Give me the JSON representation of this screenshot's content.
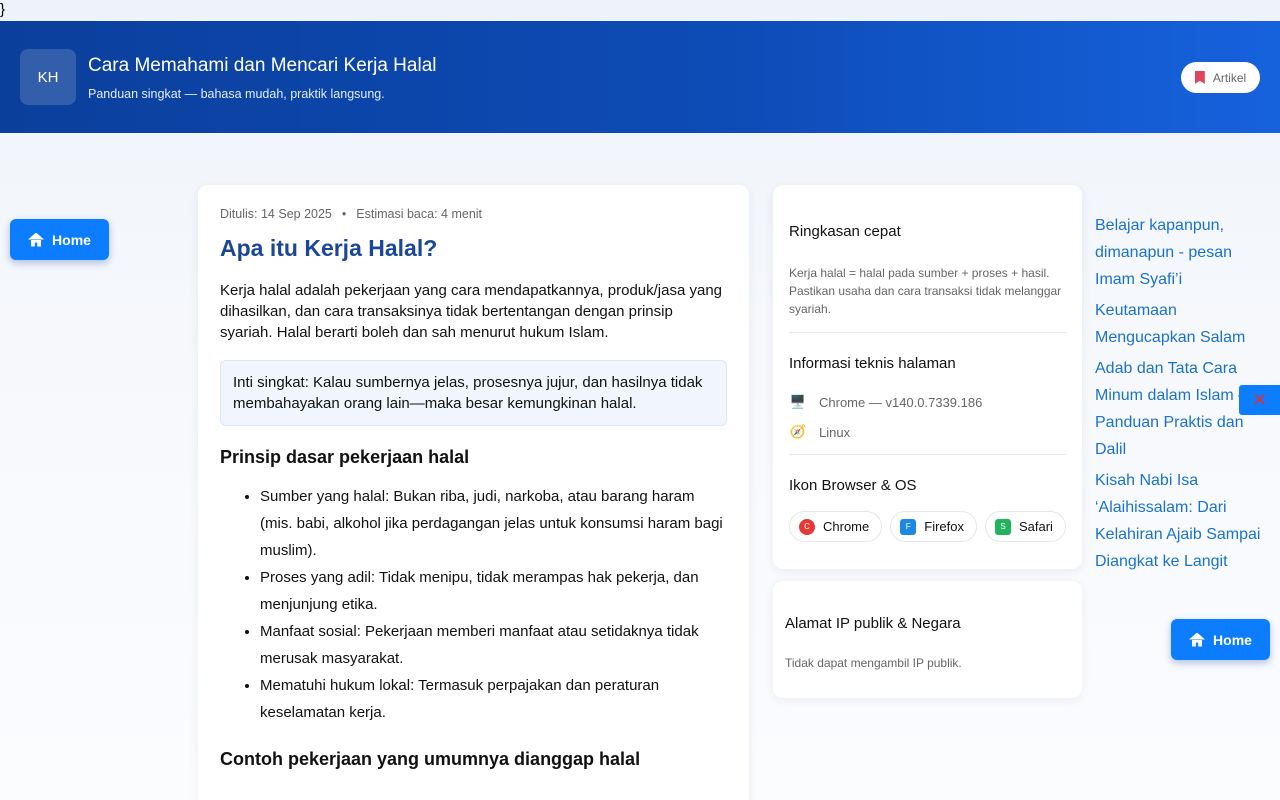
{
  "stray_text": "}",
  "header": {
    "logo_text": "KH",
    "title": "Cara Memahami dan Mencari Kerja Halal",
    "subtitle": "Panduan singkat — bahasa mudah, praktik langsung.",
    "badge_label": "Artikel",
    "badge_icon": "bookmark-icon"
  },
  "home_button": {
    "label": "Home",
    "icon": "home-icon",
    "color": "#0d7dff"
  },
  "article": {
    "meta_date": "Ditulis: 14 Sep 2025",
    "meta_separator": "•",
    "meta_read": "Estimasi baca: 4 menit",
    "title": "Apa itu Kerja Halal?",
    "intro": "Kerja halal adalah pekerjaan yang cara mendapatkannya, produk/jasa yang dihasilkan, dan cara transaksinya tidak bertentangan dengan prinsip syariah. Halal berarti boleh dan sah menurut hukum Islam.",
    "callout": "Inti singkat: Kalau sumbernya jelas, prosesnya jujur, dan hasilnya tidak membahayakan orang lain—maka besar kemungkinan halal.",
    "principles_heading": "Prinsip dasar pekerjaan halal",
    "principles": [
      "Sumber yang halal: Bukan riba, judi, narkoba, atau barang haram (mis. babi, alkohol jika perdagangan jelas untuk konsumsi haram bagi muslim).",
      "Proses yang adil: Tidak menipu, tidak merampas hak pekerja, dan menjunjung etika.",
      "Manfaat sosial: Pekerjaan memberi manfaat atau setidaknya tidak merusak masyarakat.",
      "Mematuhi hukum lokal: Termasuk perpajakan dan peraturan keselamatan kerja."
    ],
    "examples_heading": "Contoh pekerjaan yang umumnya dianggap halal"
  },
  "summary": {
    "quick_heading": "Ringkasan cepat",
    "quick_text": "Kerja halal = halal pada sumber + proses + hasil. Pastikan usaha dan cara transaksi tidak melanggar syariah.",
    "tech_heading": "Informasi teknis halaman",
    "browser_info": "Chrome — v140.0.7339.186",
    "browser_icon": "computer-icon",
    "os_info": "Linux",
    "os_icon": "compass-icon",
    "icons_heading": "Ikon Browser & OS",
    "chips": [
      {
        "label": "Chrome",
        "letter": "C",
        "color": "#e53935"
      },
      {
        "label": "Firefox",
        "letter": "F",
        "color": "#1e88e5"
      },
      {
        "label": "Safari",
        "letter": "S",
        "color": "#22b35e"
      }
    ]
  },
  "ip_card": {
    "heading": "Alamat IP publik & Negara",
    "text": "Tidak dapat mengambil IP publik."
  },
  "related_links": [
    "Belajar kapanpun, dimanapun - pesan Imam Syafi’i",
    "Keutamaan Mengucapkan Salam",
    "Adab dan Tata Cara Minum dalam Islam – Panduan Praktis dan Dalil",
    "Kisah Nabi Isa ‘Alaihissalam: Dari Kelahiran Ajaib Sampai Diangkat ke Langit"
  ],
  "close_button": {
    "glyph": "✕",
    "icon": "close-icon"
  }
}
